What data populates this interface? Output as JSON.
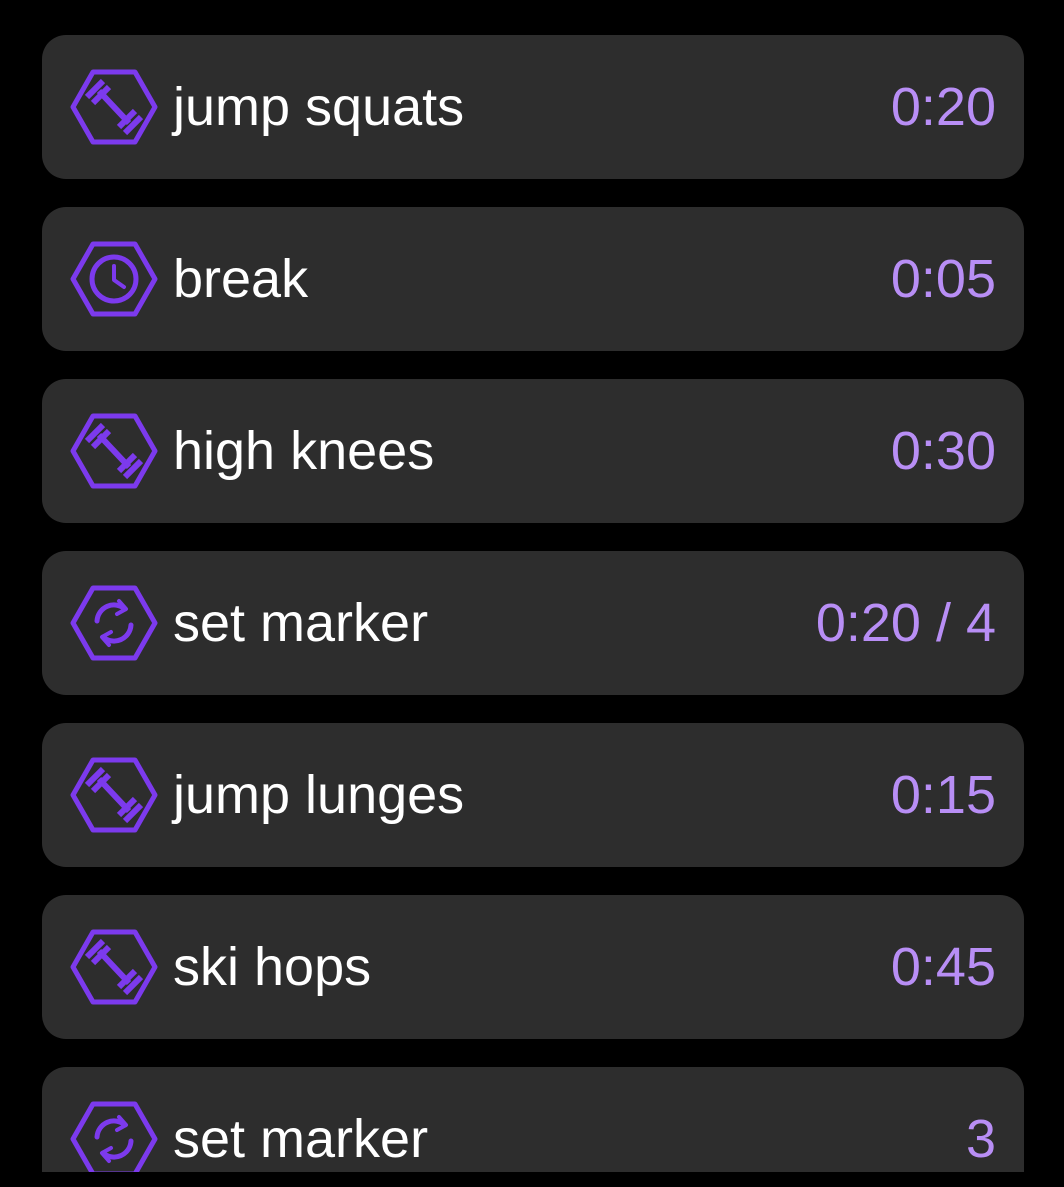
{
  "colors": {
    "background": "#000000",
    "card": "#2d2d2d",
    "accent": "#7c3aed",
    "value_text": "#b88ef5",
    "label_text": "#ffffff"
  },
  "items": [
    {
      "icon": "dumbbell-hexagon-icon",
      "label": "jump squats",
      "value": "0:20"
    },
    {
      "icon": "clock-hexagon-icon",
      "label": "break",
      "value": "0:05"
    },
    {
      "icon": "dumbbell-hexagon-icon",
      "label": "high knees",
      "value": "0:30"
    },
    {
      "icon": "repeat-hexagon-icon",
      "label": "set marker",
      "value": "0:20 / 4"
    },
    {
      "icon": "dumbbell-hexagon-icon",
      "label": "jump lunges",
      "value": "0:15"
    },
    {
      "icon": "dumbbell-hexagon-icon",
      "label": "ski hops",
      "value": "0:45"
    },
    {
      "icon": "repeat-hexagon-icon",
      "label": "set marker",
      "value": "3"
    }
  ]
}
